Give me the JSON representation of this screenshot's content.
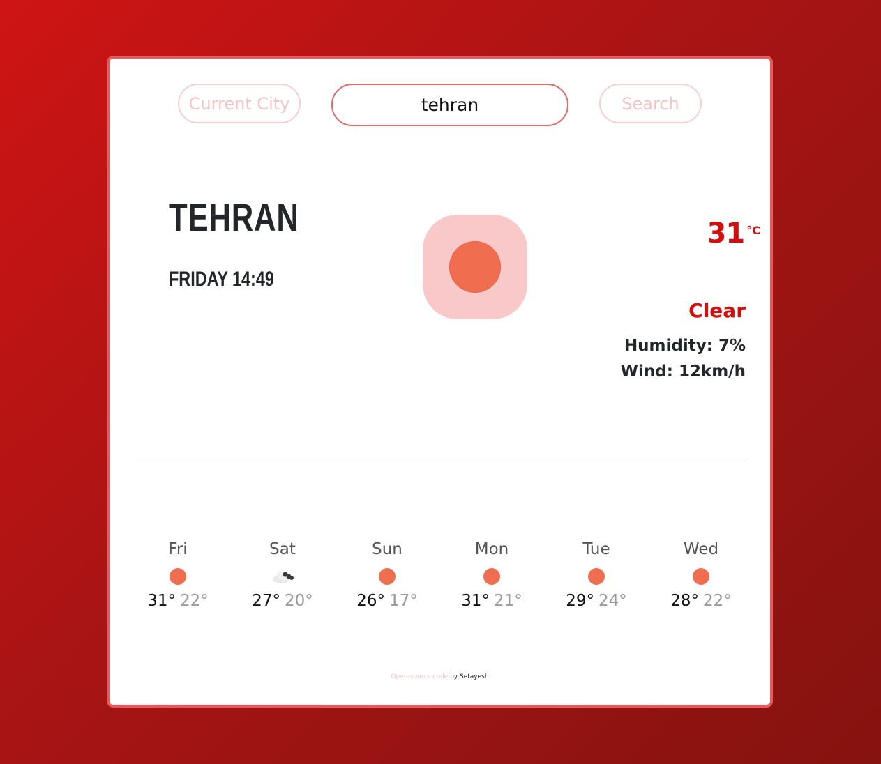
{
  "controls": {
    "current_city_label": "Current City",
    "search_value": "tehran",
    "search_label": "Search"
  },
  "weather": {
    "city": "TEHRAN",
    "date_time": "FRIDAY 14:49",
    "temperature": "31",
    "unit": "°C",
    "condition": "Clear",
    "humidity": "Humidity: 7%",
    "wind": "Wind: 12km/h",
    "main_icon": "sun-icon"
  },
  "forecast": [
    {
      "day": "Fri",
      "max": "31°",
      "min": "22°",
      "icon": "sun-icon"
    },
    {
      "day": "Sat",
      "max": "27°",
      "min": "20°",
      "icon": "cloud-icon"
    },
    {
      "day": "Sun",
      "max": "26°",
      "min": "17°",
      "icon": "sun-icon"
    },
    {
      "day": "Mon",
      "max": "31°",
      "min": "21°",
      "icon": "sun-icon"
    },
    {
      "day": "Tue",
      "max": "29°",
      "min": "24°",
      "icon": "sun-icon"
    },
    {
      "day": "Wed",
      "max": "28°",
      "min": "22°",
      "icon": "sun-icon"
    }
  ],
  "footer": {
    "link_text": "Open-source code",
    "credit": " by Setayesh"
  },
  "colors": {
    "accent": "#d40d0d",
    "sun": "#ef6e4f",
    "icon_bg": "#f9c8c8"
  }
}
